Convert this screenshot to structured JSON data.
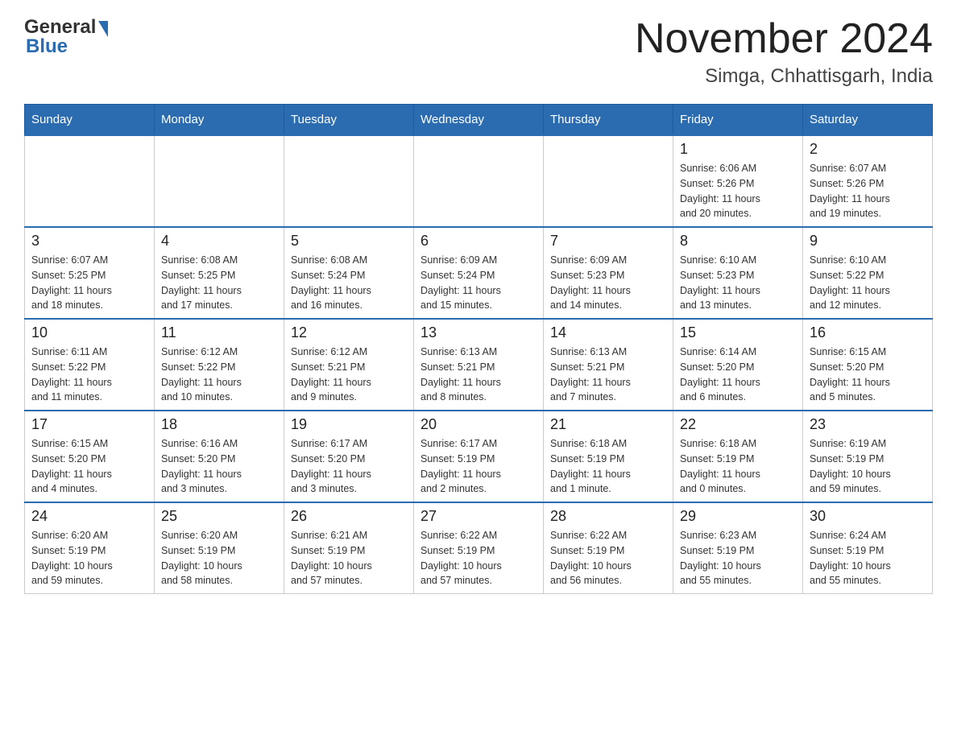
{
  "header": {
    "title": "November 2024",
    "subtitle": "Simga, Chhattisgarh, India",
    "logo_general": "General",
    "logo_blue": "Blue"
  },
  "weekdays": [
    "Sunday",
    "Monday",
    "Tuesday",
    "Wednesday",
    "Thursday",
    "Friday",
    "Saturday"
  ],
  "weeks": [
    [
      {
        "day": "",
        "info": ""
      },
      {
        "day": "",
        "info": ""
      },
      {
        "day": "",
        "info": ""
      },
      {
        "day": "",
        "info": ""
      },
      {
        "day": "",
        "info": ""
      },
      {
        "day": "1",
        "info": "Sunrise: 6:06 AM\nSunset: 5:26 PM\nDaylight: 11 hours\nand 20 minutes."
      },
      {
        "day": "2",
        "info": "Sunrise: 6:07 AM\nSunset: 5:26 PM\nDaylight: 11 hours\nand 19 minutes."
      }
    ],
    [
      {
        "day": "3",
        "info": "Sunrise: 6:07 AM\nSunset: 5:25 PM\nDaylight: 11 hours\nand 18 minutes."
      },
      {
        "day": "4",
        "info": "Sunrise: 6:08 AM\nSunset: 5:25 PM\nDaylight: 11 hours\nand 17 minutes."
      },
      {
        "day": "5",
        "info": "Sunrise: 6:08 AM\nSunset: 5:24 PM\nDaylight: 11 hours\nand 16 minutes."
      },
      {
        "day": "6",
        "info": "Sunrise: 6:09 AM\nSunset: 5:24 PM\nDaylight: 11 hours\nand 15 minutes."
      },
      {
        "day": "7",
        "info": "Sunrise: 6:09 AM\nSunset: 5:23 PM\nDaylight: 11 hours\nand 14 minutes."
      },
      {
        "day": "8",
        "info": "Sunrise: 6:10 AM\nSunset: 5:23 PM\nDaylight: 11 hours\nand 13 minutes."
      },
      {
        "day": "9",
        "info": "Sunrise: 6:10 AM\nSunset: 5:22 PM\nDaylight: 11 hours\nand 12 minutes."
      }
    ],
    [
      {
        "day": "10",
        "info": "Sunrise: 6:11 AM\nSunset: 5:22 PM\nDaylight: 11 hours\nand 11 minutes."
      },
      {
        "day": "11",
        "info": "Sunrise: 6:12 AM\nSunset: 5:22 PM\nDaylight: 11 hours\nand 10 minutes."
      },
      {
        "day": "12",
        "info": "Sunrise: 6:12 AM\nSunset: 5:21 PM\nDaylight: 11 hours\nand 9 minutes."
      },
      {
        "day": "13",
        "info": "Sunrise: 6:13 AM\nSunset: 5:21 PM\nDaylight: 11 hours\nand 8 minutes."
      },
      {
        "day": "14",
        "info": "Sunrise: 6:13 AM\nSunset: 5:21 PM\nDaylight: 11 hours\nand 7 minutes."
      },
      {
        "day": "15",
        "info": "Sunrise: 6:14 AM\nSunset: 5:20 PM\nDaylight: 11 hours\nand 6 minutes."
      },
      {
        "day": "16",
        "info": "Sunrise: 6:15 AM\nSunset: 5:20 PM\nDaylight: 11 hours\nand 5 minutes."
      }
    ],
    [
      {
        "day": "17",
        "info": "Sunrise: 6:15 AM\nSunset: 5:20 PM\nDaylight: 11 hours\nand 4 minutes."
      },
      {
        "day": "18",
        "info": "Sunrise: 6:16 AM\nSunset: 5:20 PM\nDaylight: 11 hours\nand 3 minutes."
      },
      {
        "day": "19",
        "info": "Sunrise: 6:17 AM\nSunset: 5:20 PM\nDaylight: 11 hours\nand 3 minutes."
      },
      {
        "day": "20",
        "info": "Sunrise: 6:17 AM\nSunset: 5:19 PM\nDaylight: 11 hours\nand 2 minutes."
      },
      {
        "day": "21",
        "info": "Sunrise: 6:18 AM\nSunset: 5:19 PM\nDaylight: 11 hours\nand 1 minute."
      },
      {
        "day": "22",
        "info": "Sunrise: 6:18 AM\nSunset: 5:19 PM\nDaylight: 11 hours\nand 0 minutes."
      },
      {
        "day": "23",
        "info": "Sunrise: 6:19 AM\nSunset: 5:19 PM\nDaylight: 10 hours\nand 59 minutes."
      }
    ],
    [
      {
        "day": "24",
        "info": "Sunrise: 6:20 AM\nSunset: 5:19 PM\nDaylight: 10 hours\nand 59 minutes."
      },
      {
        "day": "25",
        "info": "Sunrise: 6:20 AM\nSunset: 5:19 PM\nDaylight: 10 hours\nand 58 minutes."
      },
      {
        "day": "26",
        "info": "Sunrise: 6:21 AM\nSunset: 5:19 PM\nDaylight: 10 hours\nand 57 minutes."
      },
      {
        "day": "27",
        "info": "Sunrise: 6:22 AM\nSunset: 5:19 PM\nDaylight: 10 hours\nand 57 minutes."
      },
      {
        "day": "28",
        "info": "Sunrise: 6:22 AM\nSunset: 5:19 PM\nDaylight: 10 hours\nand 56 minutes."
      },
      {
        "day": "29",
        "info": "Sunrise: 6:23 AM\nSunset: 5:19 PM\nDaylight: 10 hours\nand 55 minutes."
      },
      {
        "day": "30",
        "info": "Sunrise: 6:24 AM\nSunset: 5:19 PM\nDaylight: 10 hours\nand 55 minutes."
      }
    ]
  ]
}
